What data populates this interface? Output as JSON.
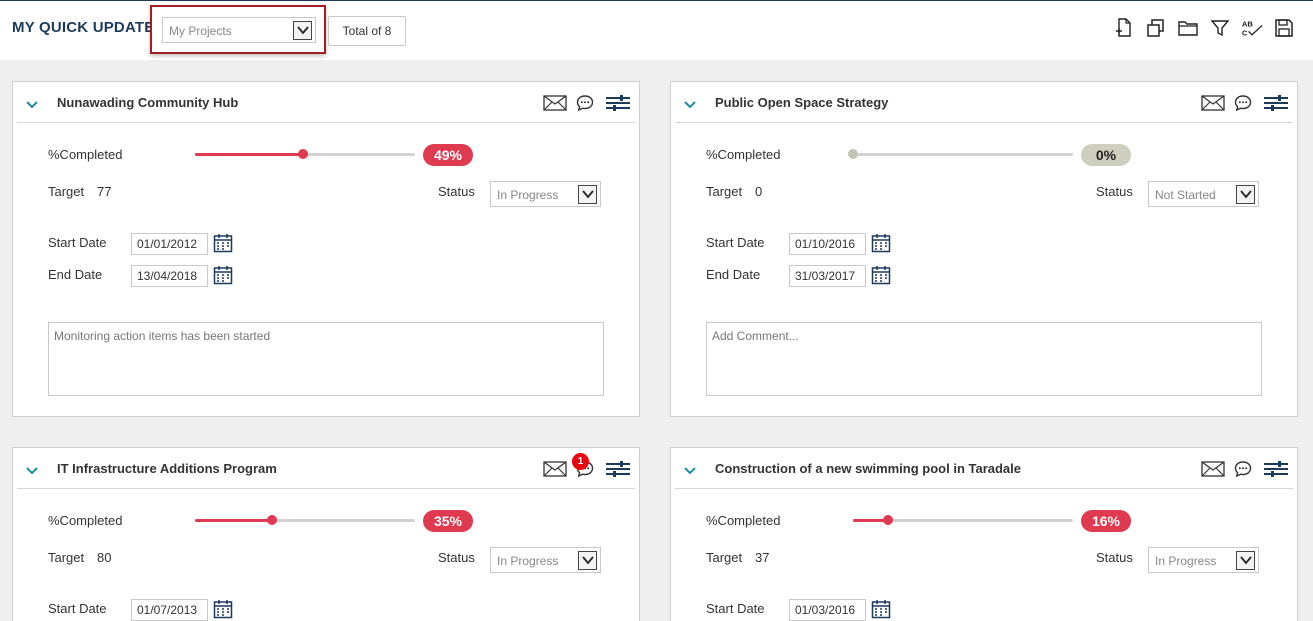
{
  "header": {
    "title": "MY QUICK UPDATE",
    "project_filter": "My Projects",
    "total_label": "Total of 8",
    "toolbar_icons": [
      "add-document-icon",
      "copy-icon",
      "folder-icon",
      "filter-icon",
      "spell-check-icon",
      "save-icon"
    ]
  },
  "labels": {
    "completed": "%Completed",
    "target": "Target",
    "status": "Status",
    "start_date": "Start Date",
    "end_date": "End Date"
  },
  "colors": {
    "accent": "#e03a51",
    "header_text": "#1d3a5a",
    "zero_progress": "#cfcfbf",
    "highlight_border": "#a31d24",
    "notification": "#e8000f"
  },
  "projects": [
    {
      "title": "Nunawading Community Hub",
      "percent": 49,
      "percent_label": "49%",
      "target": "77",
      "status": "In Progress",
      "start_date": "01/01/2012",
      "end_date": "13/04/2018",
      "comment": "Monitoring action items has been started",
      "comment_placeholder": ""
    },
    {
      "title": "Public Open Space Strategy",
      "percent": 0,
      "percent_label": "0%",
      "target": "0",
      "status": "Not Started",
      "start_date": "01/10/2016",
      "end_date": "31/03/2017",
      "comment": "",
      "comment_placeholder": "Add Comment..."
    },
    {
      "title": "IT Infrastructure Additions Program",
      "percent": 35,
      "percent_label": "35%",
      "target": "80",
      "status": "In Progress",
      "start_date": "01/07/2013",
      "notification_count": "1"
    },
    {
      "title": "Construction of a new swimming pool in Taradale",
      "percent": 16,
      "percent_label": "16%",
      "target": "37",
      "status": "In Progress",
      "start_date": "01/03/2016"
    }
  ]
}
